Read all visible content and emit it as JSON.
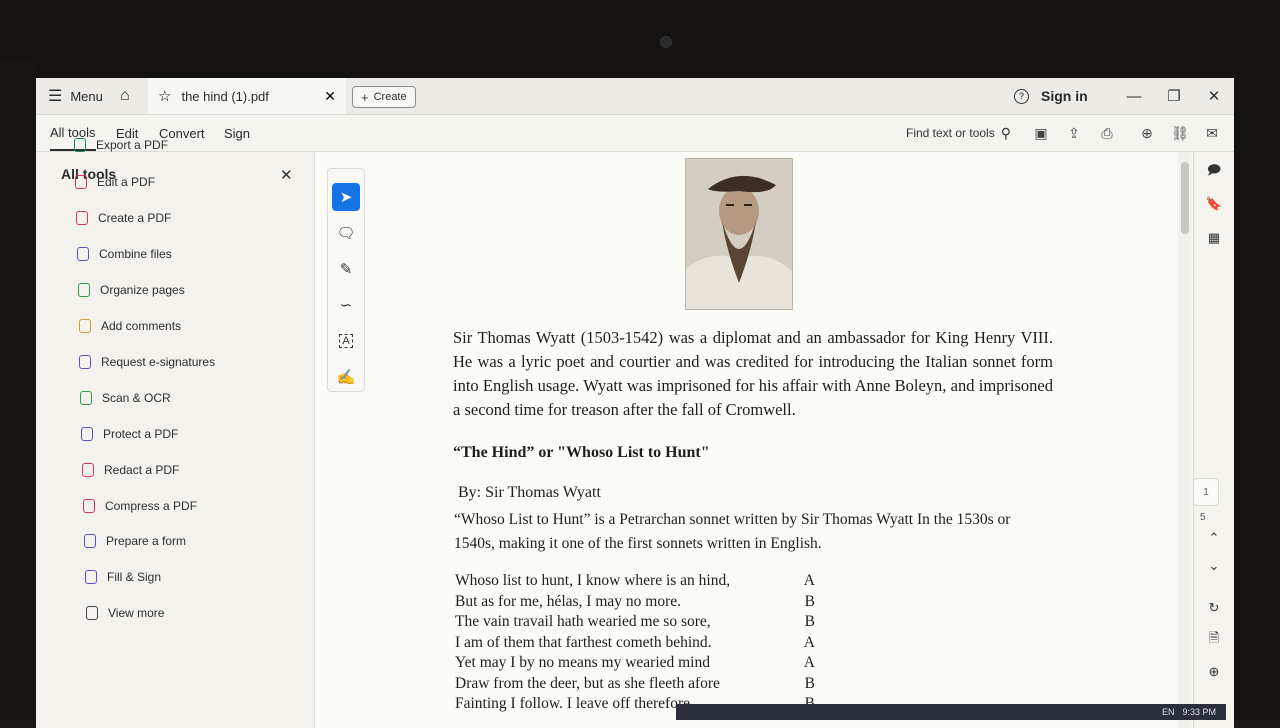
{
  "titlebar": {
    "menu_label": "Menu",
    "tab_title": "the hind (1).pdf",
    "create_label": "Create",
    "sign_in_label": "Sign in"
  },
  "menubar": {
    "tabs": [
      "All tools",
      "Edit",
      "Convert",
      "Sign"
    ],
    "find_label": "Find text or tools"
  },
  "left_panel": {
    "title": "All tools",
    "items": [
      {
        "label": "Export a PDF",
        "icon": "export-pdf-icon",
        "color": "#1b8a6f"
      },
      {
        "label": "Edit a PDF",
        "icon": "edit-pdf-icon",
        "color": "#d6365b"
      },
      {
        "label": "Create a PDF",
        "icon": "create-pdf-icon",
        "color": "#d6365b"
      },
      {
        "label": "Combine files",
        "icon": "combine-files-icon",
        "color": "#5a52c9"
      },
      {
        "label": "Organize pages",
        "icon": "organize-pages-icon",
        "color": "#2a9d4a"
      },
      {
        "label": "Add comments",
        "icon": "comment-icon",
        "color": "#c9a42b"
      },
      {
        "label": "Request e-signatures",
        "icon": "e-signature-icon",
        "color": "#6c4cc7"
      },
      {
        "label": "Scan & OCR",
        "icon": "scan-ocr-icon",
        "color": "#2a9d4a"
      },
      {
        "label": "Protect a PDF",
        "icon": "protect-pdf-icon",
        "color": "#5a52c9"
      },
      {
        "label": "Redact a PDF",
        "icon": "redact-pdf-icon",
        "color": "#d6365b"
      },
      {
        "label": "Compress a PDF",
        "icon": "compress-pdf-icon",
        "color": "#d6365b"
      },
      {
        "label": "Prepare a form",
        "icon": "prepare-form-icon",
        "color": "#5a52c9"
      },
      {
        "label": "Fill & Sign",
        "icon": "fill-sign-icon",
        "color": "#6c4cc7"
      },
      {
        "label": "View more",
        "icon": "view-more-icon",
        "color": "#444444"
      }
    ]
  },
  "document": {
    "paragraph": "Sir Thomas Wyatt (1503-1542) was a diplomat and an ambassador for King Henry VIII. He was a lyric poet and courtier and was credited for introducing the Italian sonnet form into English usage. Wyatt was imprisoned for his affair with Anne Boleyn, and imprisoned a second time for treason after the fall of Cromwell.",
    "heading": "“The Hind” or \"Whoso List to Hunt\"",
    "byline": "By: Sir Thomas Wyatt",
    "intro": "“Whoso List to Hunt” is a Petrarchan sonnet written by Sir Thomas Wyatt In the 1530s or 1540s, making it one of the first sonnets written in English.",
    "poem": [
      {
        "line": "Whoso list to hunt, I know where is an hind,",
        "rhyme": "A"
      },
      {
        "line": "But as for me, hélas, I may no more.",
        "rhyme": "B"
      },
      {
        "line": "The vain travail hath wearied me so sore,",
        "rhyme": "B"
      },
      {
        "line": "I am of them that farthest cometh behind.",
        "rhyme": "A"
      },
      {
        "line": "Yet may I by no means my wearied mind",
        "rhyme": "A"
      },
      {
        "line": "Draw from the deer, but as she fleeth afore",
        "rhyme": "B"
      },
      {
        "line": "Fainting I follow. I leave off therefore",
        "rhyme": "B"
      }
    ]
  },
  "right_panel": {
    "page_current": "1",
    "page_total": "5"
  },
  "taskbar": {
    "lang": "EN",
    "time": "9:33 PM"
  }
}
